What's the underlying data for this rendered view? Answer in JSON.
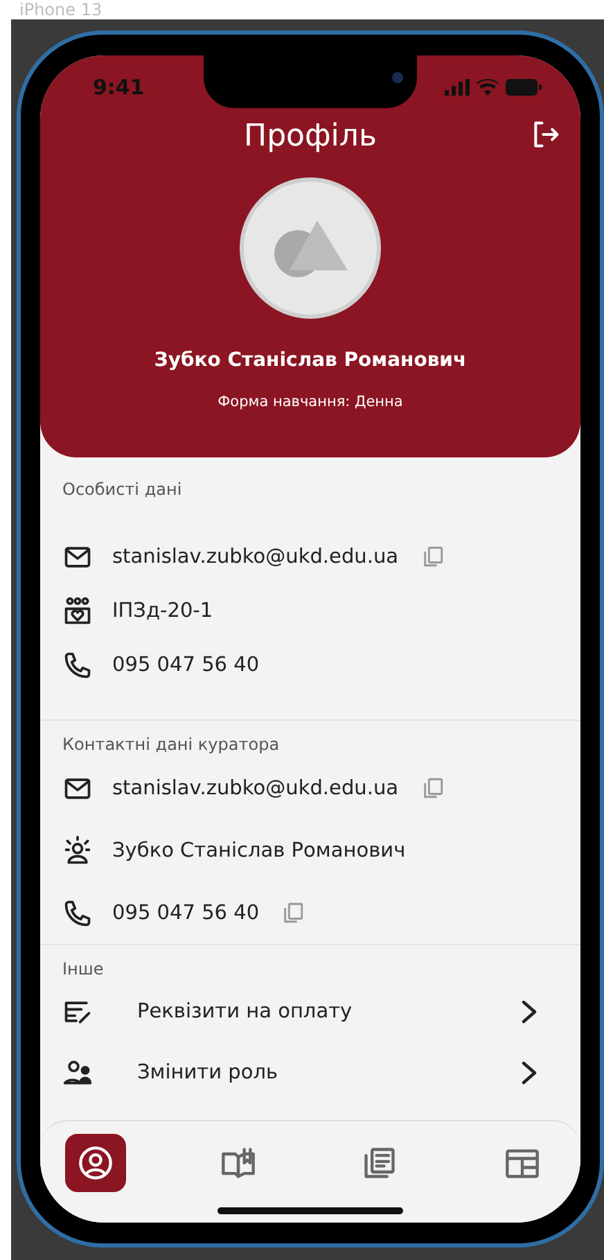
{
  "device_label": "iPhone 13",
  "status_bar": {
    "time": "9:41"
  },
  "header": {
    "title": "Профіль",
    "name": "Зубко Станіслав Романович",
    "study_form": "Форма навчання: Денна"
  },
  "sections": [
    {
      "title": "Особисті дані",
      "items": [
        {
          "kind": "email",
          "text": "stanislav.zubko@ukd.edu.ua",
          "copyable": true
        },
        {
          "kind": "group",
          "text": "ІПЗд-20-1",
          "copyable": false
        },
        {
          "kind": "phone",
          "text": "095 047 56 40",
          "copyable": false
        }
      ]
    },
    {
      "title": "Контактні дані куратора",
      "items": [
        {
          "kind": "email",
          "text": "stanislav.zubko@ukd.edu.ua",
          "copyable": true
        },
        {
          "kind": "curator",
          "text": "Зубко Станіслав Романович",
          "copyable": false
        },
        {
          "kind": "phone",
          "text": "095 047 56 40",
          "copyable": true
        }
      ]
    },
    {
      "title": "Інше",
      "items": [
        {
          "kind": "payment",
          "text": "Реквізити на оплату"
        },
        {
          "kind": "role",
          "text": "Змінити роль"
        }
      ]
    }
  ],
  "nav": [
    {
      "kind": "profile",
      "selected": true
    },
    {
      "kind": "book",
      "selected": false
    },
    {
      "kind": "news",
      "selected": false
    },
    {
      "kind": "schedule",
      "selected": false
    }
  ]
}
